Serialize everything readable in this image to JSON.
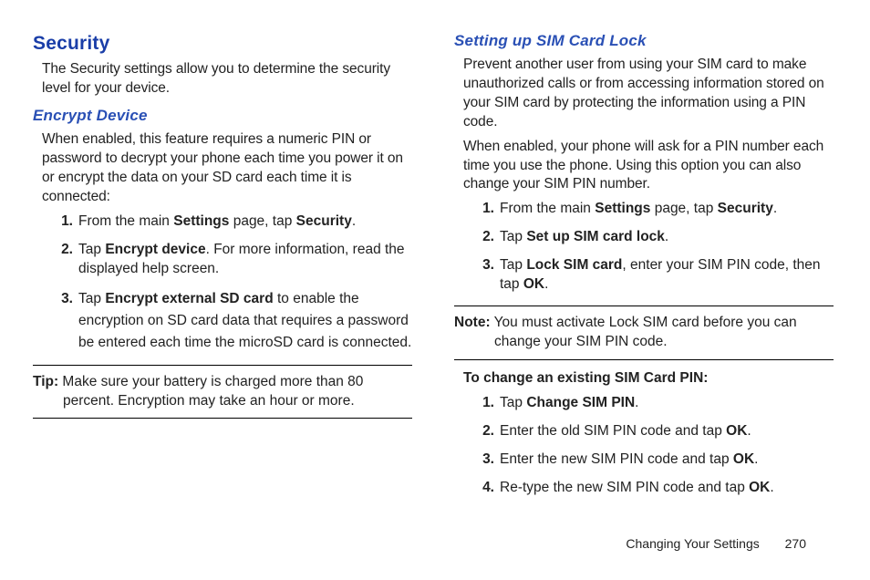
{
  "left": {
    "h1": "Security",
    "intro": "The Security settings allow you to determine the security level for your device.",
    "h2a": "Encrypt Device",
    "p2": "When enabled, this feature requires a numeric PIN or password to decrypt your phone each time you power it on or encrypt the data on your SD card each time it is connected:",
    "s1": {
      "n": "1.",
      "pre": "From the main ",
      "b1": "Settings",
      "mid": " page, tap ",
      "b2": "Security",
      "post": "."
    },
    "s2": {
      "n": "2.",
      "pre": "Tap ",
      "b1": "Encrypt device",
      "post": ". For more information, read the displayed help screen."
    },
    "s3": {
      "n": "3.",
      "pre": "Tap ",
      "b1": "Encrypt external SD card",
      "post": " to enable the encryption on SD card data that requires a password be entered each time the microSD card is connected."
    },
    "tip_label": "Tip:",
    "tip_text": " Make sure your battery is charged more than 80 percent. Encryption may take an hour or more."
  },
  "right": {
    "h2b": "Setting up SIM Card Lock",
    "r1": "Prevent another user from using your SIM card to make unauthorized calls or from accessing information stored on your SIM card by protecting the information using a PIN code.",
    "r2": "When enabled, your phone will ask for a PIN number each time you use the phone. Using this option you can also change your SIM PIN number.",
    "rs1": {
      "n": "1.",
      "pre": "From the main ",
      "b1": "Settings",
      "mid": " page, tap ",
      "b2": "Security",
      "post": "."
    },
    "rs2": {
      "n": "2.",
      "pre": "Tap ",
      "b1": "Set up SIM card lock",
      "post": "."
    },
    "rs3": {
      "n": "3.",
      "pre": "Tap ",
      "b1": "Lock SIM card",
      "mid": ", enter your SIM PIN code, then tap ",
      "b2": "OK",
      "post": "."
    },
    "note_label": "Note:",
    "note_text": " You must activate Lock SIM card before you can change your SIM PIN code.",
    "sub2": "To change an existing SIM Card PIN:",
    "cs1": {
      "n": "1.",
      "pre": "Tap ",
      "b1": "Change SIM PIN",
      "post": "."
    },
    "cs2": {
      "n": "2.",
      "pre": "Enter the old SIM PIN code and tap ",
      "b1": "OK",
      "post": "."
    },
    "cs3": {
      "n": "3.",
      "pre": "Enter the new SIM PIN code and tap ",
      "b1": "OK",
      "post": "."
    },
    "cs4": {
      "n": "4.",
      "pre": "Re-type the new SIM PIN code and tap ",
      "b1": "OK",
      "post": "."
    }
  },
  "footer": {
    "chapter": "Changing Your Settings",
    "page": "270"
  }
}
